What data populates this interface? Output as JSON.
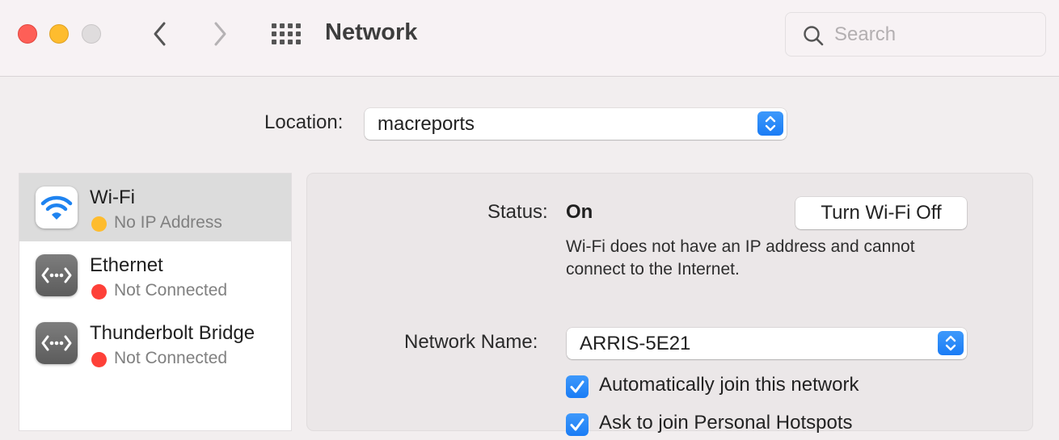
{
  "window": {
    "title": "Network",
    "controls": [
      "close",
      "minimize",
      "zoom"
    ],
    "nav": {
      "back": "chevron-left-icon",
      "forward": "chevron-right-icon",
      "show_all": "grid-icon"
    }
  },
  "search": {
    "placeholder": "Search",
    "value": ""
  },
  "location": {
    "label": "Location:",
    "value": "macreports"
  },
  "services": [
    {
      "name": "Wi-Fi",
      "status": "No IP Address",
      "status_color": "#febc2e",
      "icon": "wifi-icon",
      "selected": true
    },
    {
      "name": "Ethernet",
      "status": "Not Connected",
      "status_color": "#fe4038",
      "icon": "ethernet-icon",
      "selected": false
    },
    {
      "name": "Thunderbolt Bridge",
      "status": "Not Connected",
      "status_color": "#fe4038",
      "icon": "ethernet-icon",
      "selected": false
    }
  ],
  "detail": {
    "status_label": "Status:",
    "status_value": "On",
    "turn_off_label": "Turn Wi-Fi Off",
    "status_description": "Wi-Fi does not have an IP address and cannot connect to the Internet.",
    "network_name_label": "Network Name:",
    "network_name_value": "ARRIS-5E21",
    "checkboxes": [
      {
        "label": "Automatically join this network",
        "checked": true
      },
      {
        "label": "Ask to join Personal Hotspots",
        "checked": true
      }
    ]
  },
  "colors": {
    "accent": "#1a7cf5",
    "wifi_blue": "#1e83f0"
  }
}
